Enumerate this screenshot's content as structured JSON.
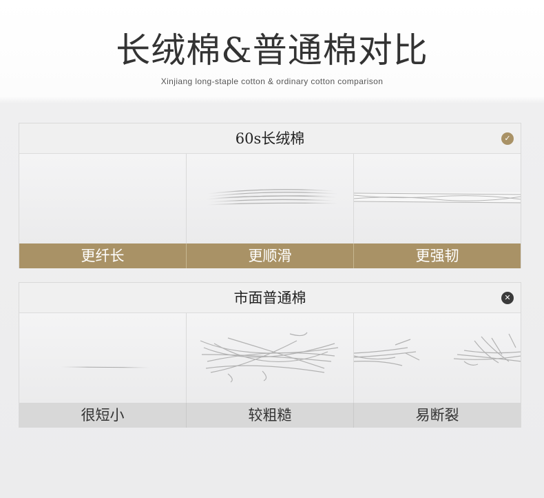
{
  "title": "长绒棉&普通棉对比",
  "subtitle": "Xinjiang long-staple cotton & ordinary cotton comparison",
  "colors": {
    "gold": "#a99266",
    "grey": "#d8d8d8"
  },
  "long_staple": {
    "heading": "60s长绒棉",
    "badge_icon": "check-circle-icon",
    "features": [
      "更纤长",
      "更顺滑",
      "更强韧"
    ]
  },
  "ordinary": {
    "heading": "市面普通棉",
    "badge_icon": "close-circle-icon",
    "features": [
      "很短小",
      "较粗糙",
      "易断裂"
    ]
  }
}
